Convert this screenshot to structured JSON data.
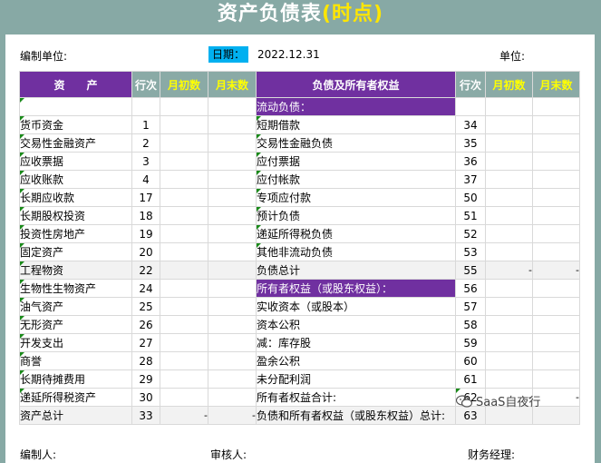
{
  "title": {
    "main": "资产负债表",
    "accent": "(时点)"
  },
  "meta": {
    "unit_left": "编制单位:",
    "date_label": "日期：",
    "date_value": "2022.12.31",
    "unit_right": "单位:"
  },
  "headers": {
    "assets": "资　　产",
    "row": "行次",
    "begin": "月初数",
    "end": "月末数",
    "liab": "负债及所有者权益",
    "row2": "行次",
    "begin2": "月初数",
    "end2": "月末数"
  },
  "rows": [
    {
      "a": "",
      "an": "",
      "l": "流动负债：",
      "ln": ""
    },
    {
      "a": "货币资金",
      "an": "1",
      "l": "短期借款",
      "ln": "34"
    },
    {
      "a": "交易性金融资产",
      "an": "2",
      "l": "交易性金融负债",
      "ln": "35"
    },
    {
      "a": "应收票据",
      "an": "3",
      "l": "应付票据",
      "ln": "36"
    },
    {
      "a": "应收账款",
      "an": "4",
      "l": "应付帐款",
      "ln": "37"
    },
    {
      "a": "长期应收款",
      "an": "17",
      "l": "专项应付款",
      "ln": "50"
    },
    {
      "a": "长期股权投资",
      "an": "18",
      "l": "预计负债",
      "ln": "51"
    },
    {
      "a": "投资性房地产",
      "an": "19",
      "l": "递延所得税负债",
      "ln": "52"
    },
    {
      "a": "固定资产",
      "an": "20",
      "l": "其他非流动负债",
      "ln": "53"
    },
    {
      "a": "工程物资",
      "an": "22",
      "l": "负债总计",
      "ln": "55",
      "l_dash1": "-",
      "l_dash2": "-"
    },
    {
      "a": "生物性生物资产",
      "an": "24",
      "l": "所有者权益（或股东权益）：",
      "ln": "56"
    },
    {
      "a": "油气资产",
      "an": "25",
      "l": "实收资本（或股本）",
      "ln": "57"
    },
    {
      "a": "无形资产",
      "an": "26",
      "l": "资本公积",
      "ln": "58"
    },
    {
      "a": "开发支出",
      "an": "27",
      "l": "减：库存股",
      "ln": "59"
    },
    {
      "a": "商誉",
      "an": "28",
      "l": "盈余公积",
      "ln": "60"
    },
    {
      "a": "长期待摊费用",
      "an": "29",
      "l": "未分配利润",
      "ln": "61"
    },
    {
      "a": "递延所得税资产",
      "an": "30",
      "l": "所有者权益合计:",
      "ln": "62",
      "l_dash1": "-",
      "l_dash2": "-"
    }
  ],
  "total": {
    "a": "资产总计",
    "an": "33",
    "a_dash1": "-",
    "a_dash2": "-",
    "l": "负债和所有者权益（或股东权益）总计:",
    "ln": "63"
  },
  "footer": {
    "maker": "编制人:",
    "checker": "审核人:",
    "manager": "财务经理:"
  },
  "watermark": "SaaS自夜行"
}
